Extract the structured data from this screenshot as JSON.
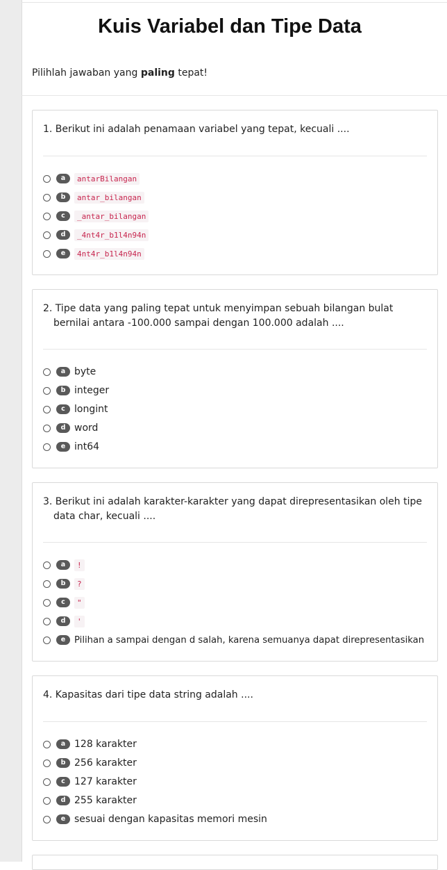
{
  "page": {
    "title": "Kuis Variabel dan Tipe Data",
    "intro_pre": "Pilihlah jawaban yang ",
    "intro_bold": "paling",
    "intro_post": " tepat!"
  },
  "questions": [
    {
      "text": "1. Berikut ini adalah penamaan variabel yang tepat, kecuali ....",
      "options": [
        {
          "letter": "a",
          "text": "antarBilangan",
          "code": true
        },
        {
          "letter": "b",
          "text": "antar_bilangan",
          "code": true
        },
        {
          "letter": "c",
          "text": "_antar_bilangan",
          "code": true
        },
        {
          "letter": "d",
          "text": "_4nt4r_b1l4n94n",
          "code": true
        },
        {
          "letter": "e",
          "text": "4nt4r_b1l4n94n",
          "code": true
        }
      ]
    },
    {
      "text": "2. Tipe data yang paling tepat untuk menyimpan sebuah bilangan bulat bernilai antara -100.000 sampai dengan 100.000 adalah ....",
      "options": [
        {
          "letter": "a",
          "text": "byte",
          "code": false
        },
        {
          "letter": "b",
          "text": "integer",
          "code": false
        },
        {
          "letter": "c",
          "text": "longint",
          "code": false
        },
        {
          "letter": "d",
          "text": "word",
          "code": false
        },
        {
          "letter": "e",
          "text": "int64",
          "code": false
        }
      ]
    },
    {
      "text": "3. Berikut ini adalah karakter-karakter yang dapat direpresentasikan oleh tipe data char, kecuali ....",
      "options": [
        {
          "letter": "a",
          "text": "!",
          "code": true
        },
        {
          "letter": "b",
          "text": "?",
          "code": true
        },
        {
          "letter": "c",
          "text": "\"",
          "code": true
        },
        {
          "letter": "d",
          "text": "'",
          "code": true
        },
        {
          "letter": "e",
          "text": "Pilihan a sampai dengan d salah, karena semuanya dapat direpresentasikan",
          "code": false
        }
      ]
    },
    {
      "text": "4. Kapasitas dari tipe data string adalah ....",
      "options": [
        {
          "letter": "a",
          "text": "128 karakter",
          "code": false
        },
        {
          "letter": "b",
          "text": "256 karakter",
          "code": false
        },
        {
          "letter": "c",
          "text": "127 karakter",
          "code": false
        },
        {
          "letter": "d",
          "text": "255 karakter",
          "code": false
        },
        {
          "letter": "e",
          "text": "sesuai dengan kapasitas memori mesin",
          "code": false
        }
      ]
    }
  ]
}
